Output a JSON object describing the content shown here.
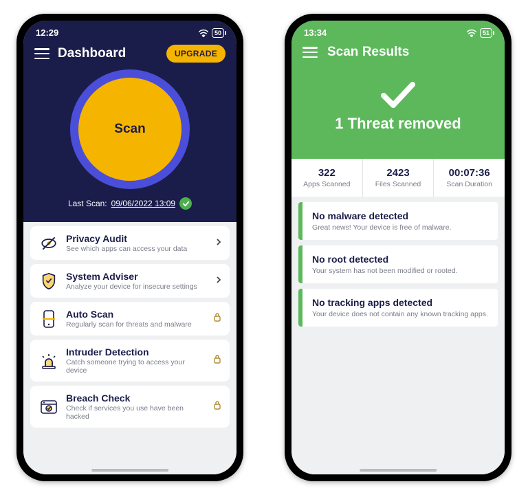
{
  "phone1": {
    "status": {
      "time": "12:29",
      "battery": "50"
    },
    "header": {
      "title": "Dashboard",
      "upgrade_label": "UPGRADE"
    },
    "scan": {
      "button_label": "Scan",
      "last_scan_prefix": "Last Scan:",
      "last_scan_ts": "09/06/2022 13:09"
    },
    "features": [
      {
        "icon": "eye-off",
        "title": "Privacy Audit",
        "desc": "See which apps can access your data",
        "accessory": "chevron"
      },
      {
        "icon": "shield-check",
        "title": "System Adviser",
        "desc": "Analyze your device for insecure settings",
        "accessory": "chevron"
      },
      {
        "icon": "phone-scan",
        "title": "Auto Scan",
        "desc": "Regularly scan for threats and malware",
        "accessory": "lock"
      },
      {
        "icon": "siren",
        "title": "Intruder Detection",
        "desc": "Catch someone trying to access your device",
        "accessory": "lock"
      },
      {
        "icon": "browser-check",
        "title": "Breach Check",
        "desc": "Check if services you use have been hacked",
        "accessory": "lock"
      }
    ]
  },
  "phone2": {
    "status": {
      "time": "13:34",
      "battery": "51"
    },
    "header": {
      "title": "Scan Results",
      "banner": "1 Threat removed"
    },
    "stats": [
      {
        "value": "322",
        "label": "Apps Scanned"
      },
      {
        "value": "2423",
        "label": "Files Scanned"
      },
      {
        "value": "00:07:36",
        "label": "Scan Duration"
      }
    ],
    "results": [
      {
        "title": "No malware detected",
        "desc": "Great news! Your device is free of malware."
      },
      {
        "title": "No root detected",
        "desc": "Your system has not been modified or rooted."
      },
      {
        "title": "No tracking apps detected",
        "desc": "Your device does not contain any known tracking apps."
      }
    ]
  },
  "colors": {
    "dark_navy": "#1a1d4a",
    "accent_yellow": "#f5b400",
    "accent_blue_ring": "#4a4ed8",
    "success_green": "#5db85c"
  }
}
